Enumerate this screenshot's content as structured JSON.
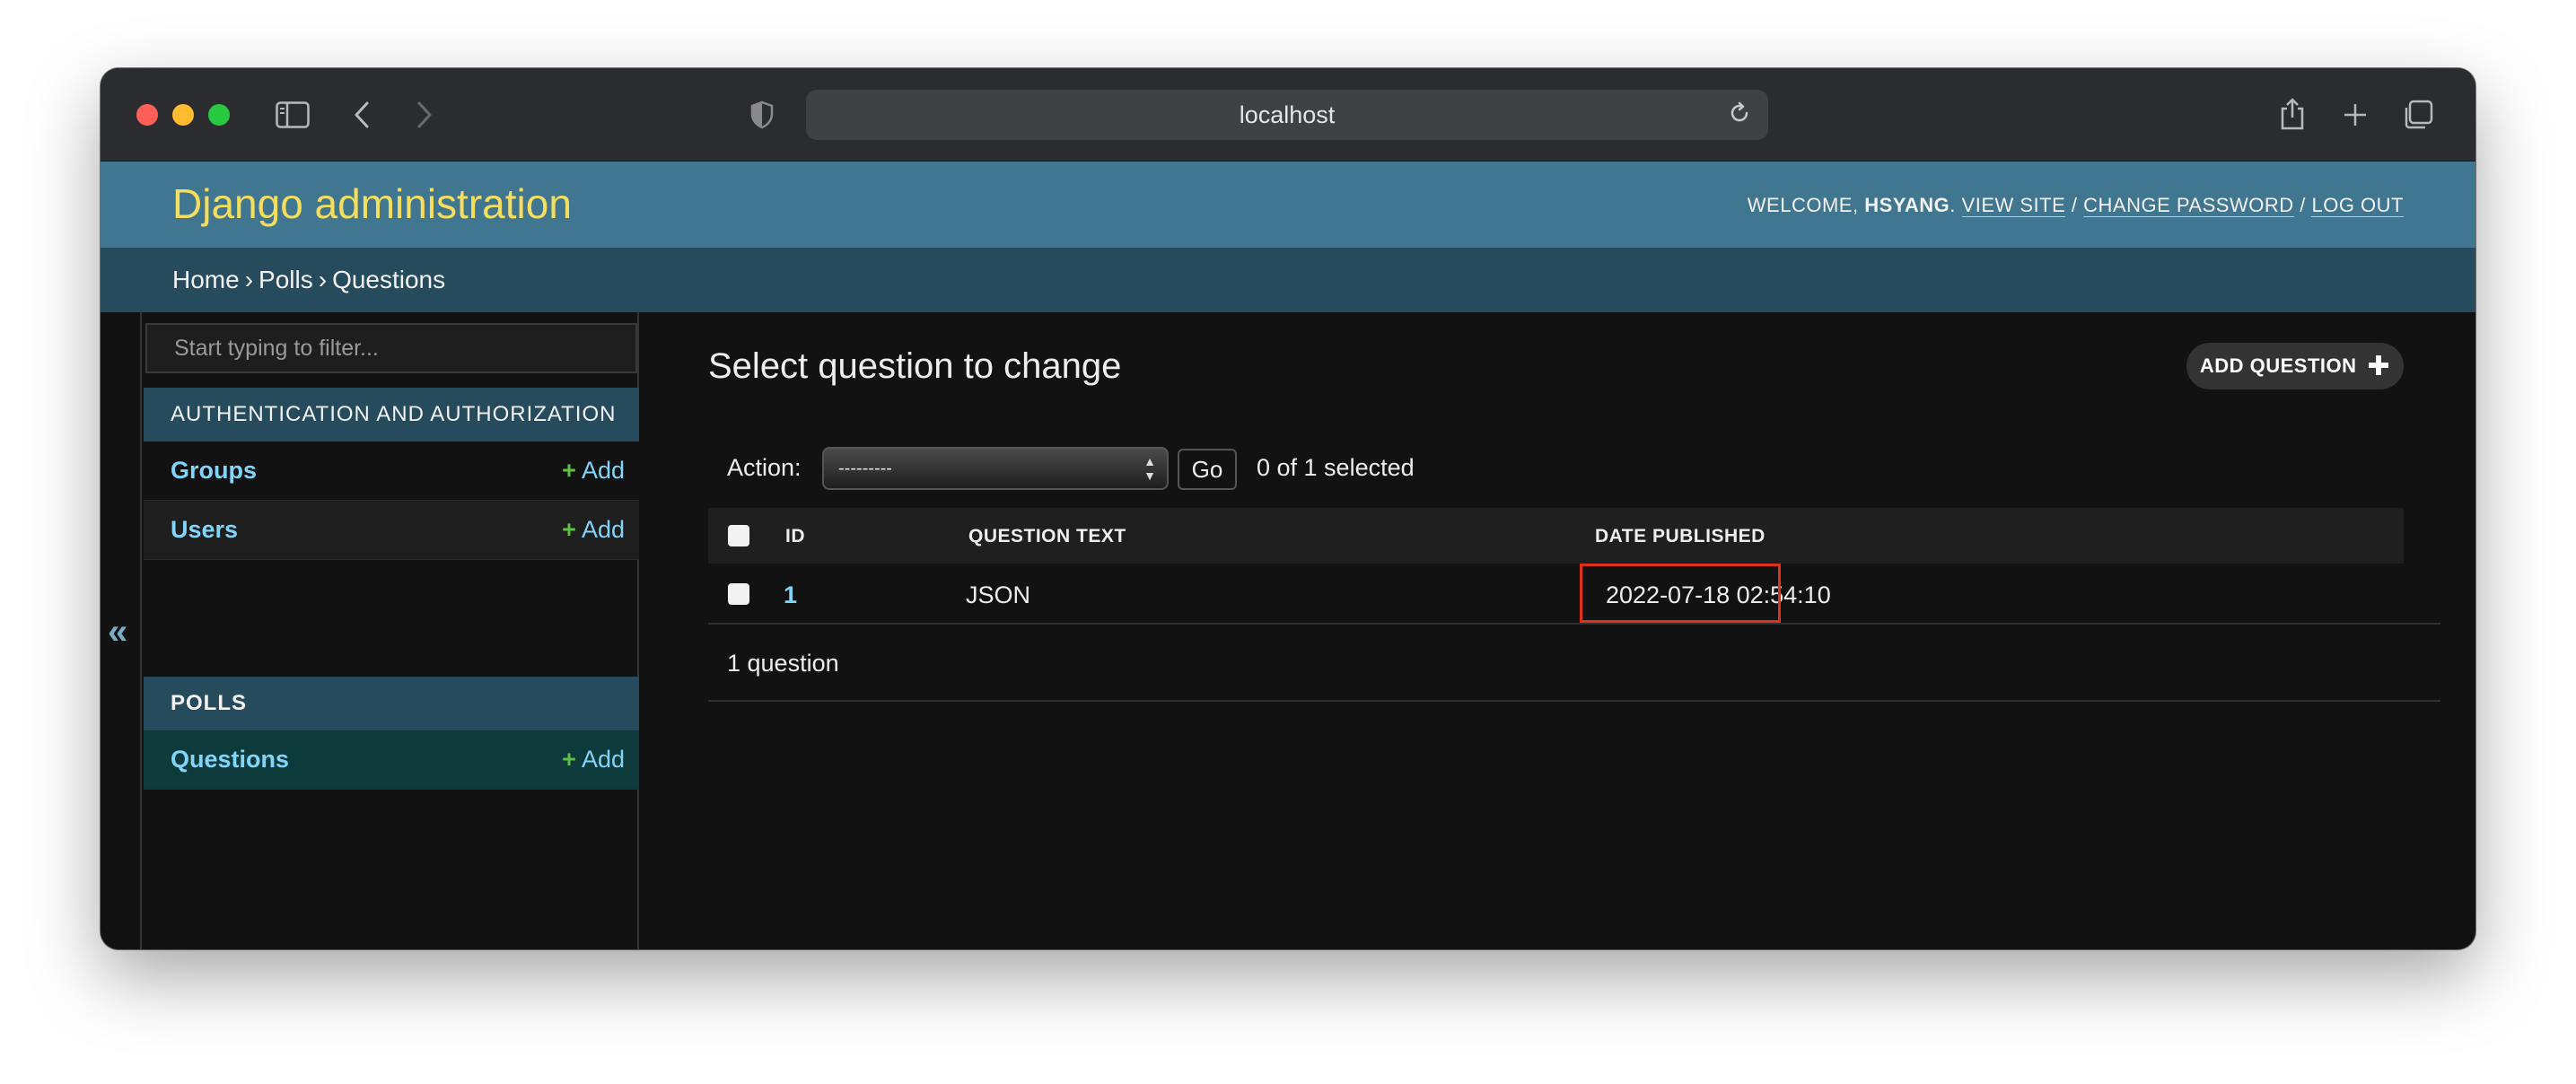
{
  "browser": {
    "url": "localhost"
  },
  "header": {
    "branding": "Django administration",
    "welcome": "WELCOME,",
    "username": "HSYANG",
    "view_site": "VIEW SITE",
    "change_password": "CHANGE PASSWORD",
    "log_out": "LOG OUT",
    "separator": "/"
  },
  "breadcrumbs": {
    "home": "Home",
    "app": "Polls",
    "current": "Questions",
    "separator": "›"
  },
  "sidebar": {
    "filter_placeholder": "Start typing to filter...",
    "collapse_glyph": "«",
    "apps": [
      {
        "caption": "AUTHENTICATION AND AUTHORIZATION",
        "models": [
          {
            "name": "Groups",
            "add": "Add"
          },
          {
            "name": "Users",
            "add": "Add"
          }
        ]
      },
      {
        "caption": "POLLS",
        "models": [
          {
            "name": "Questions",
            "add": "Add"
          }
        ]
      }
    ]
  },
  "content": {
    "title": "Select question to change",
    "add_button": "ADD QUESTION",
    "action_label": "Action:",
    "action_selected": "---------",
    "go_button": "Go",
    "selection_count": "0 of 1 selected",
    "columns": [
      "ID",
      "QUESTION TEXT",
      "DATE PUBLISHED"
    ],
    "rows": [
      {
        "id": "1",
        "question_text": "JSON",
        "date_published": "2022-07-18 02:54:10"
      }
    ],
    "paginator": "1 question"
  },
  "colors": {
    "header_bg": "#417690",
    "breadcrumbs_bg": "#264b5d",
    "branding": "#f5dd5d",
    "link": "#81d4fa",
    "add_plus": "#5fbf46",
    "highlight_box": "#e0301e"
  }
}
